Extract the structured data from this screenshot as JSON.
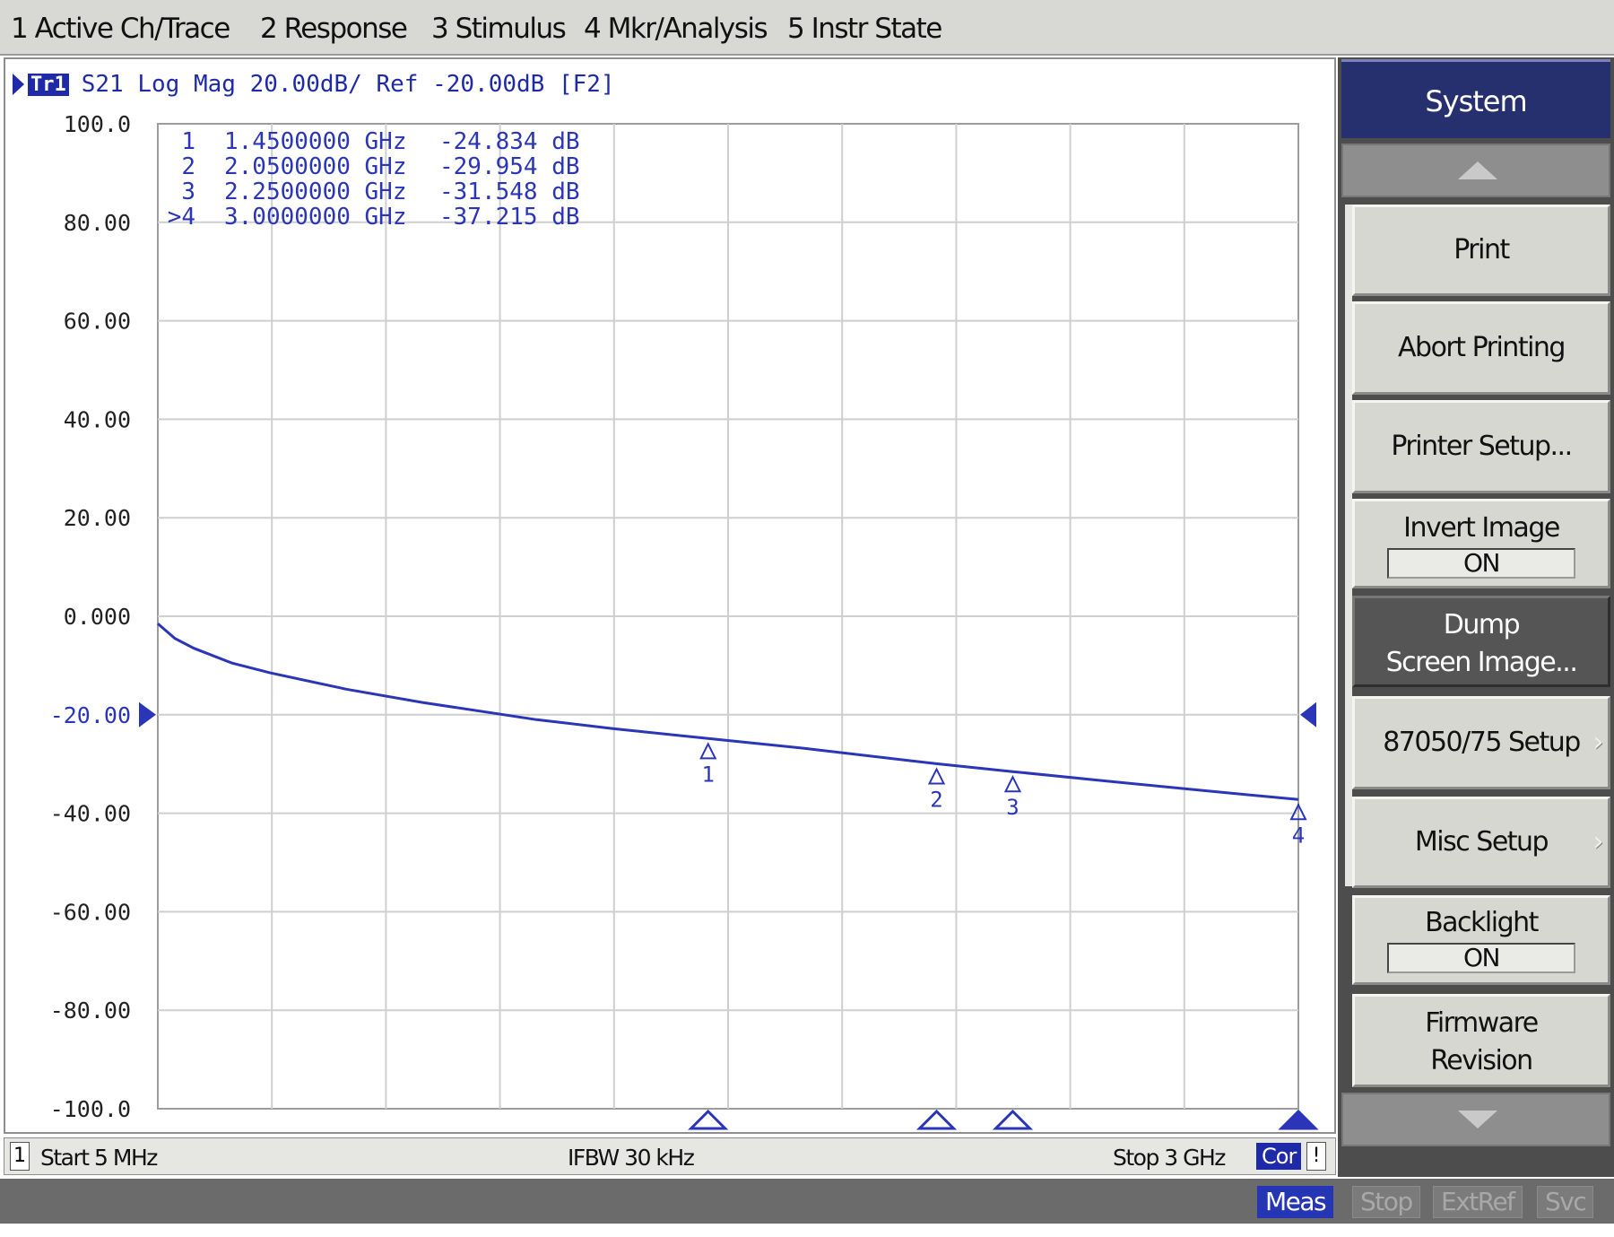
{
  "menu": {
    "items": [
      "1 Active Ch/Trace",
      "2 Response",
      "3 Stimulus",
      "4 Mkr/Analysis",
      "5 Instr State"
    ]
  },
  "trace": {
    "badge": "Tr1",
    "header": "S21 Log Mag 20.00dB/ Ref -20.00dB [F2]"
  },
  "markers_table": [
    {
      "id": "1",
      "freq": "1.4500000 GHz",
      "value": "-24.834 dB"
    },
    {
      "id": "2",
      "freq": "2.0500000 GHz",
      "value": "-29.954 dB"
    },
    {
      "id": ">4",
      "label_id": "3",
      "freq": "2.2500000 GHz",
      "value": "-31.548 dB"
    },
    {
      "id": ">4",
      "freq": "3.0000000 GHz",
      "value": "-37.215 dB"
    }
  ],
  "status": {
    "channel": "1",
    "start": "Start 5 MHz",
    "ifbw": "IFBW 30 kHz",
    "stop": "Stop 3 GHz",
    "cor": "Cor",
    "bang": "!"
  },
  "indicators": {
    "meas": "Meas",
    "stop": "Stop",
    "extref": "ExtRef",
    "svc": "Svc"
  },
  "softkeys": {
    "title": "System",
    "print": "Print",
    "abort_printing": "Abort Printing",
    "printer_setup": "Printer Setup...",
    "invert_image_label": "Invert Image",
    "invert_image_value": "ON",
    "dump_line1": "Dump",
    "dump_line2": "Screen Image...",
    "setup_8705": "87050/75 Setup",
    "misc_setup": "Misc Setup",
    "backlight_label": "Backlight",
    "backlight_value": "ON",
    "firmware_line1": "Firmware",
    "firmware_line2": "Revision"
  },
  "chart_data": {
    "type": "line",
    "title": "S21 Log Mag 20.00dB/ Ref -20.00dB [F2]",
    "xlabel": "",
    "ylabel": "",
    "xlim_ghz": [
      0.005,
      3.0
    ],
    "ylim": [
      -100,
      100
    ],
    "y_ticks": [
      "100.0",
      "80.00",
      "60.00",
      "40.00",
      "20.00",
      "0.000",
      "-20.00",
      "-40.00",
      "-60.00",
      "-80.00",
      "-100.0"
    ],
    "y_tick_values": [
      100,
      80,
      60,
      40,
      20,
      0,
      -20,
      -40,
      -60,
      -80,
      -100
    ],
    "reference_level": -20,
    "x_divisions": 10,
    "grid": true,
    "series": [
      {
        "color": "#2a35b8",
        "x_ghz": [
          0.005,
          0.05,
          0.1,
          0.2,
          0.3,
          0.5,
          0.7,
          1.0,
          1.2,
          1.45,
          1.7,
          2.05,
          2.25,
          2.5,
          2.75,
          3.0
        ],
        "y_db": [
          -1.5,
          -4.5,
          -6.5,
          -9.5,
          -11.5,
          -14.8,
          -17.5,
          -21.0,
          -22.8,
          -24.834,
          -26.8,
          -29.954,
          -31.548,
          -33.5,
          -35.4,
          -37.215
        ]
      }
    ],
    "markers": [
      {
        "label": "1",
        "x_ghz": 1.45,
        "y_db": -24.834
      },
      {
        "label": "2",
        "x_ghz": 2.05,
        "y_db": -29.954
      },
      {
        "label": "3",
        "x_ghz": 2.25,
        "y_db": -31.548
      },
      {
        "label": "4",
        "x_ghz": 3.0,
        "y_db": -37.215
      }
    ]
  }
}
